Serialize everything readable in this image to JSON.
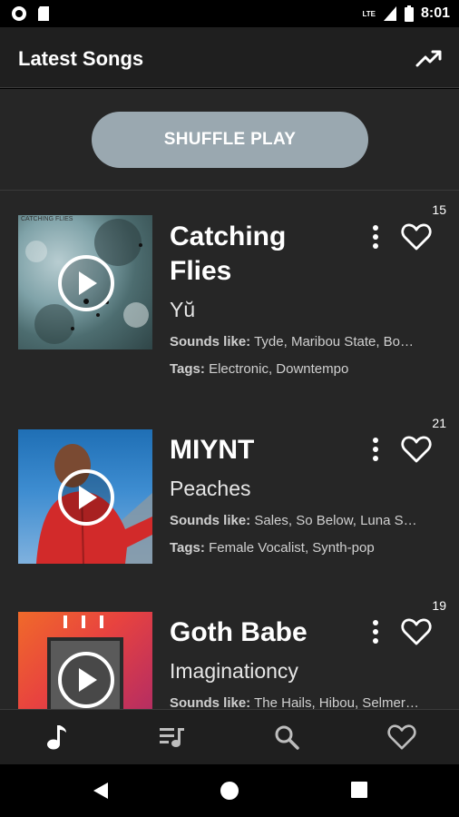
{
  "status": {
    "time": "8:01",
    "network": "LTE"
  },
  "app_bar": {
    "title": "Latest Songs"
  },
  "shuffle": {
    "label": "SHUFFLE PLAY"
  },
  "songs": [
    {
      "title": "Catching Flies",
      "artist": "Yŭ",
      "count": "15",
      "sounds_like_label": "Sounds like:",
      "sounds_like": "Tyde, Maribou State, Bo…",
      "tags_label": "Tags:",
      "tags": "Electronic, Downtempo",
      "art_text": "CATCHING FLIES"
    },
    {
      "title": "MIYNT",
      "artist": "Peaches",
      "count": "21",
      "sounds_like_label": "Sounds like:",
      "sounds_like": "Sales, So Below, Luna S…",
      "tags_label": "Tags:",
      "tags": "Female Vocalist, Synth-pop"
    },
    {
      "title": "Goth Babe",
      "artist": "Imaginationcy",
      "count": "19",
      "sounds_like_label": "Sounds like:",
      "sounds_like": "The Hails, Hibou, Selmer…"
    }
  ],
  "icons": {
    "status_left": [
      "record-icon",
      "sd-card-icon"
    ],
    "status_right": [
      "signal-icon",
      "battery-icon"
    ],
    "app_bar": "trending-up-icon",
    "song_actions": [
      "more-vert-icon",
      "heart-icon",
      "play-icon"
    ],
    "bottom_nav": [
      "music-note-icon",
      "queue-music-icon",
      "search-icon",
      "heart-icon"
    ],
    "system_nav": [
      "back-icon",
      "home-icon",
      "recents-icon"
    ]
  },
  "colors": {
    "background": "#262626",
    "app_bar": "#1f1f1f",
    "shuffle_button": "#9aa8b0"
  }
}
